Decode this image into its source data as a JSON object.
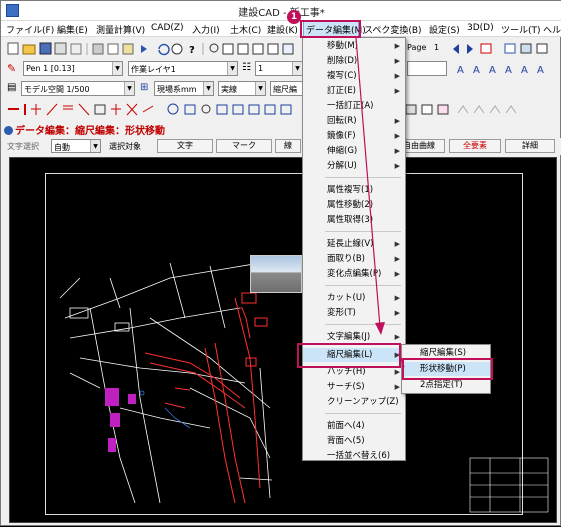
{
  "window": {
    "title": "建設CAD - 新工事*"
  },
  "menubar": {
    "items": [
      {
        "label": "ファイル(F)"
      },
      {
        "label": "編集(E)"
      },
      {
        "label": "測量計算(V)"
      },
      {
        "label": "CAD(Z)"
      },
      {
        "label": "入力(I)"
      },
      {
        "label": "土木(C)"
      },
      {
        "label": "建設(K)"
      },
      {
        "label": "データ編集(M)"
      },
      {
        "label": "スペク変換(B)"
      },
      {
        "label": "設定(S)"
      },
      {
        "label": "3D(D)"
      },
      {
        "label": "ツール(T)"
      },
      {
        "label": "ヘル"
      }
    ]
  },
  "toolbar1": {
    "page_label": "Page",
    "page_value": "1"
  },
  "toolbar2": {
    "pen_combo": "Pen 1 [0.13]",
    "layer_combo": "作業レイヤ1",
    "value_combo": "1"
  },
  "toolbar3": {
    "space_combo": "モデル空間 1/500",
    "unit_combo": "現場系mm",
    "line_combo": "実線",
    "scale_combo": "縮尺編"
  },
  "command": {
    "title": "データ編集：縮尺編集：形状移動"
  },
  "options": {
    "select_label": "文字選択",
    "select_value": "自動",
    "target_label": "選択対象",
    "buttons": [
      "文字",
      "マーク",
      "線",
      "自由曲線",
      "全要素",
      "詳細"
    ]
  },
  "menu_main": {
    "items": [
      {
        "label": "移動(M)",
        "sub": true
      },
      {
        "label": "削除(D)",
        "sub": true
      },
      {
        "label": "複写(C)",
        "sub": true
      },
      {
        "label": "訂正(E)",
        "sub": true
      },
      {
        "label": "一括訂正(A)",
        "sub": false
      },
      {
        "label": "回転(R)",
        "sub": true
      },
      {
        "label": "鏡像(F)",
        "sub": true
      },
      {
        "label": "伸縮(G)",
        "sub": true
      },
      {
        "label": "分解(U)",
        "sub": true
      },
      {
        "label": "属性複写(1)",
        "sub": false
      },
      {
        "label": "属性移動(2)",
        "sub": false
      },
      {
        "label": "属性取得(3)",
        "sub": false
      },
      {
        "label": "延長止線(V)",
        "sub": true
      },
      {
        "label": "面取り(B)",
        "sub": true
      },
      {
        "label": "変化点編集(P)",
        "sub": true
      },
      {
        "label": "カット(U)",
        "sub": true
      },
      {
        "label": "変形(T)",
        "sub": true
      },
      {
        "label": "文字編集(J)",
        "sub": true
      },
      {
        "label": "縮尺編集(L)",
        "sub": true
      },
      {
        "label": "ハッチ(H)",
        "sub": true
      },
      {
        "label": "サーチ(S)",
        "sub": true
      },
      {
        "label": "クリーンアップ(Z)",
        "sub": false
      },
      {
        "label": "前面へ(4)",
        "sub": false
      },
      {
        "label": "背面へ(5)",
        "sub": false
      },
      {
        "label": "一括並べ替え(6)",
        "sub": false
      }
    ]
  },
  "menu_sub": {
    "items": [
      {
        "label": "縮尺編集(S)"
      },
      {
        "label": "形状移動(P)"
      },
      {
        "label": "2点指定(T)"
      }
    ]
  },
  "annotation": {
    "step_number": "1"
  },
  "colors": {
    "highlight": "#c0105a",
    "menu_hover": "#cce4f7"
  }
}
